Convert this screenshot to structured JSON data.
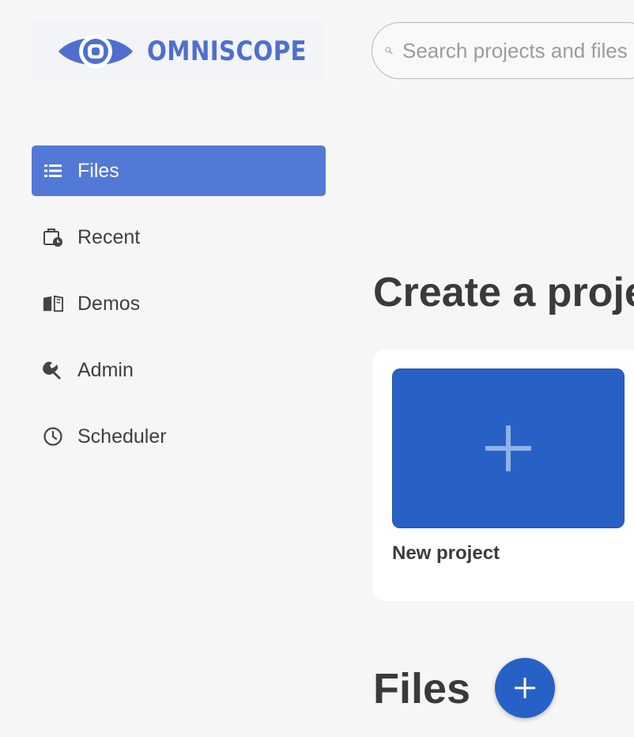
{
  "brand": {
    "name": "OMNISCOPE",
    "color": "#4f6fcf"
  },
  "search": {
    "placeholder": "Search projects and files"
  },
  "sidebar": {
    "active_color": "#5379d6",
    "items": [
      {
        "label": "Files",
        "icon": "list-icon",
        "active": true
      },
      {
        "label": "Recent",
        "icon": "briefcase-clock-icon",
        "active": false
      },
      {
        "label": "Demos",
        "icon": "open-book-icon",
        "active": false
      },
      {
        "label": "Admin",
        "icon": "wrench-icon",
        "active": false
      },
      {
        "label": "Scheduler",
        "icon": "clock-icon",
        "active": false
      }
    ]
  },
  "main": {
    "create_title": "Create a project",
    "new_project": {
      "label": "New project",
      "icon": "plus-icon",
      "color": "#2861c6"
    },
    "files_title": "Files",
    "add_file_button": {
      "icon": "plus-icon",
      "color": "#2861c6"
    }
  }
}
